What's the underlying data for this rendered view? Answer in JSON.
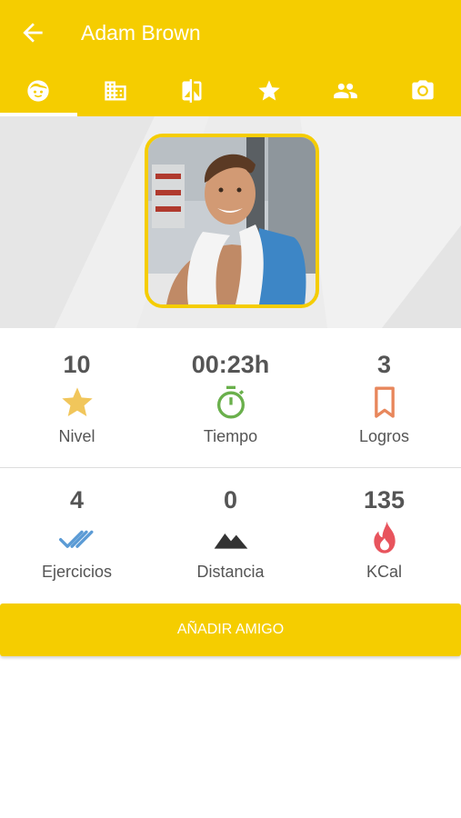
{
  "header": {
    "title": "Adam Brown"
  },
  "tabs": [
    {
      "name": "face-icon"
    },
    {
      "name": "building-icon"
    },
    {
      "name": "compare-icon"
    },
    {
      "name": "star-icon"
    },
    {
      "name": "people-icon"
    },
    {
      "name": "camera-icon"
    }
  ],
  "stats_row1": [
    {
      "value": "10",
      "label": "Nivel",
      "icon": "star-icon",
      "color": "#f1c65b"
    },
    {
      "value": "00:23h",
      "label": "Tiempo",
      "icon": "stopwatch-icon",
      "color": "#6ab04c"
    },
    {
      "value": "3",
      "label": "Logros",
      "icon": "bookmark-icon",
      "color": "#e8875c"
    }
  ],
  "stats_row2": [
    {
      "value": "4",
      "label": "Ejercicios",
      "icon": "double-check-icon",
      "color": "#5b9bd5"
    },
    {
      "value": "0",
      "label": "Distancia",
      "icon": "mountain-icon",
      "color": "#333333"
    },
    {
      "value": "135",
      "label": "KCal",
      "icon": "flame-icon",
      "color": "#e8545d"
    }
  ],
  "action": {
    "label": "AÑADIR AMIGO"
  },
  "colors": {
    "accent": "#f5cd00"
  }
}
